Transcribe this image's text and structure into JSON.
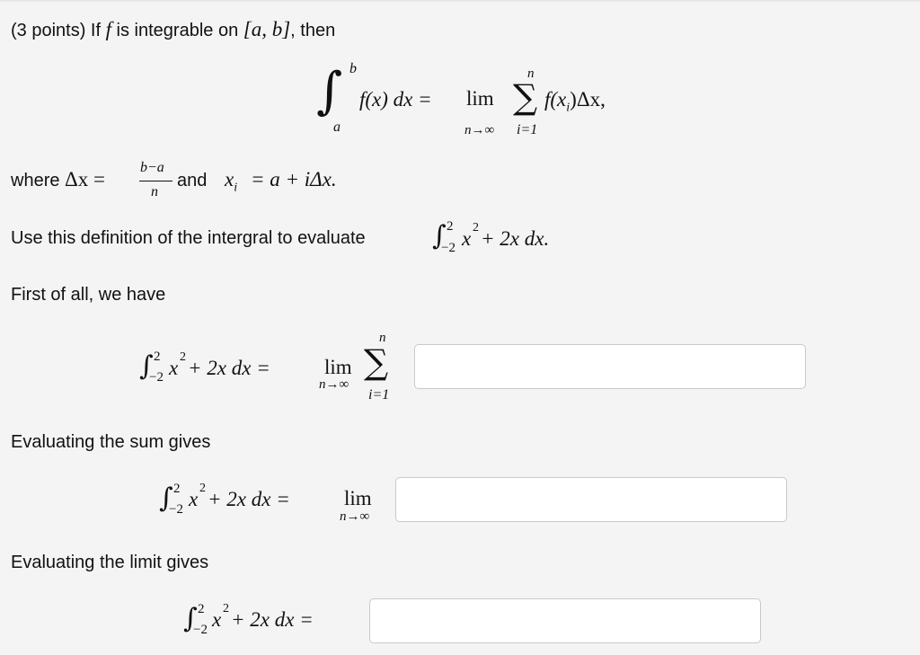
{
  "intro": {
    "prefix": "(3 points) If ",
    "f": "f",
    "mid": " is integrable on ",
    "interval": "[a, b]",
    "suffix": ", then"
  },
  "definition": {
    "upper": "b",
    "lower": "a",
    "integrand": "f(x) dx =",
    "lim": "lim",
    "lim_sub": "n→∞",
    "sum_upper": "n",
    "sum_lower": "i=1",
    "sum_body": "f(x",
    "sum_sub": "i",
    "sum_tail": ")Δx,"
  },
  "where": {
    "prefix": "where ",
    "dx": "Δx =",
    "numerator": "b−a",
    "denominator": "n",
    "and": " and ",
    "xi": "x",
    "xi_sub": "i",
    "xi_def": "= a + iΔx."
  },
  "task": {
    "text": "Use this definition of the intergral to evaluate ",
    "int_upper": "2",
    "int_lower": "−2",
    "expr_x": "x",
    "expr_exp": "2",
    "expr_rest": " + 2x dx."
  },
  "step1": {
    "label": "First of all, we have",
    "int_upper": "2",
    "int_lower": "−2",
    "expr_x": "x",
    "expr_exp": "2",
    "expr_rest": " + 2x dx =",
    "lim": "lim",
    "lim_sub": "n→∞",
    "sum_upper": "n",
    "sum_lower": "i=1",
    "answer_value": ""
  },
  "step2": {
    "label": "Evaluating the sum gives",
    "int_upper": "2",
    "int_lower": "−2",
    "expr_x": "x",
    "expr_exp": "2",
    "expr_rest": " + 2x dx =",
    "lim": "lim",
    "lim_sub": "n→∞",
    "answer_value": ""
  },
  "step3": {
    "label": "Evaluating the limit gives",
    "int_upper": "2",
    "int_lower": "−2",
    "expr_x": "x",
    "expr_exp": "2",
    "expr_rest": " + 2x dx =",
    "answer_value": ""
  }
}
